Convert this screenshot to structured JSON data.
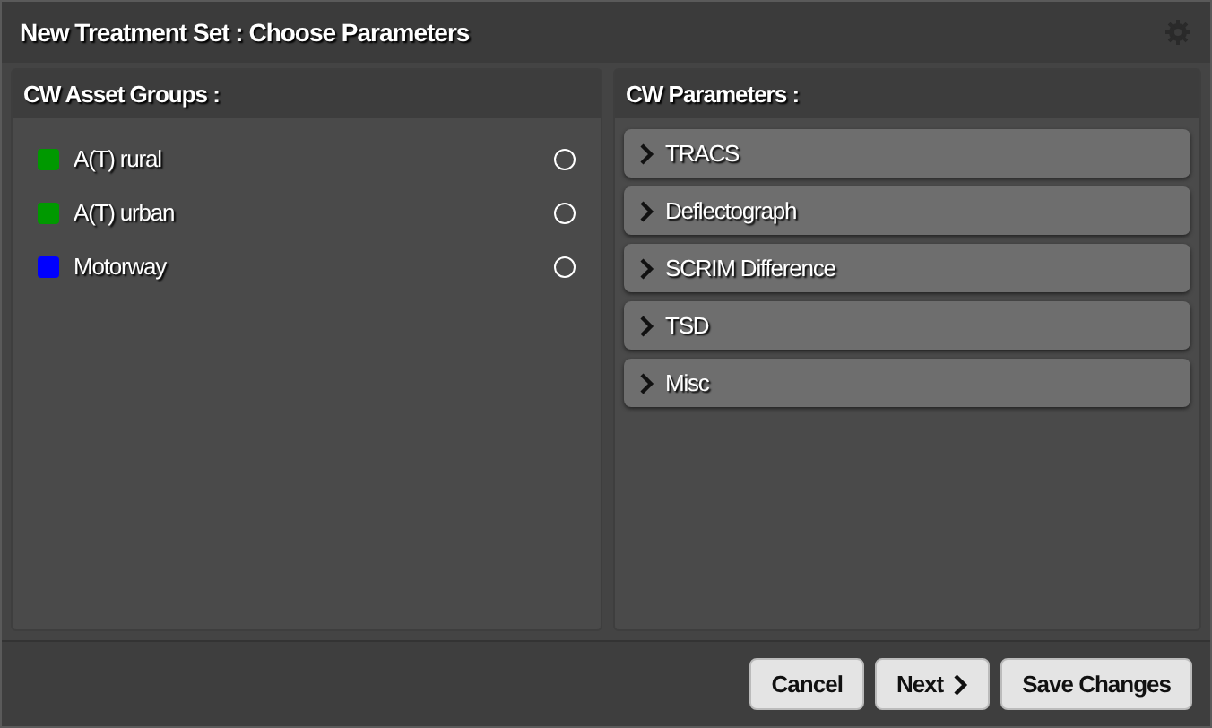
{
  "window": {
    "title": "New Treatment Set : Choose Parameters"
  },
  "asset_groups": {
    "title": "CW Asset Groups :",
    "items": [
      {
        "label": "A(T) rural",
        "color": "#009900",
        "selected": false
      },
      {
        "label": "A(T) urban",
        "color": "#009900",
        "selected": false
      },
      {
        "label": "Motorway",
        "color": "#0000ff",
        "selected": false
      }
    ]
  },
  "parameters": {
    "title": "CW Parameters :",
    "items": [
      {
        "label": "TRACS",
        "expanded": false
      },
      {
        "label": "Deflectograph",
        "expanded": false
      },
      {
        "label": "SCRIM Difference",
        "expanded": false
      },
      {
        "label": "TSD",
        "expanded": false
      },
      {
        "label": "Misc",
        "expanded": false
      }
    ]
  },
  "buttons": [
    {
      "label": "Cancel",
      "kind": "plain"
    },
    {
      "label": "Next",
      "kind": "next"
    },
    {
      "label": "Save Changes",
      "kind": "plain"
    }
  ]
}
